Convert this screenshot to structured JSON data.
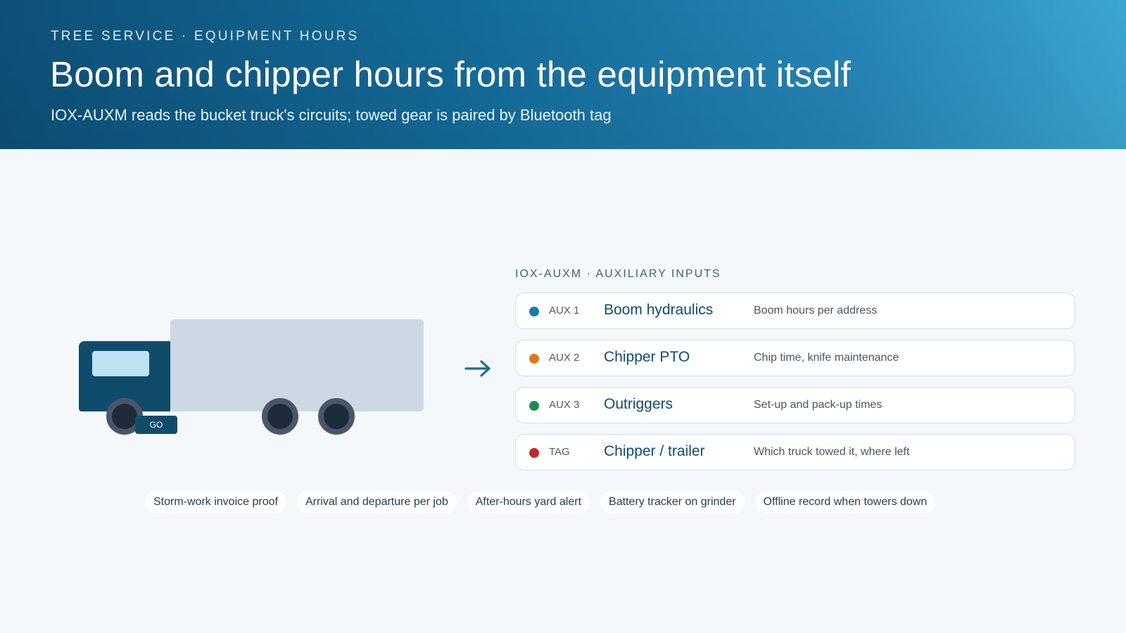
{
  "header": {
    "eyebrow": "TREE SERVICE · EQUIPMENT HOURS",
    "title": "Boom and chipper hours from the equipment itself",
    "subtitle": "IOX-AUXM reads the bucket truck's circuits; towed gear is paired by Bluetooth tag"
  },
  "truck": {
    "badge": "GO"
  },
  "aux": {
    "heading": "IOX-AUXM · AUXILIARY INPUTS",
    "rows": [
      {
        "code": "AUX 1",
        "name": "Boom hydraulics",
        "desc": "Boom hours per address",
        "color": "#1b7aa8"
      },
      {
        "code": "AUX 2",
        "name": "Chipper PTO",
        "desc": "Chip time, knife maintenance",
        "color": "#dd7a1c"
      },
      {
        "code": "AUX 3",
        "name": "Outriggers",
        "desc": "Set-up and pack-up times",
        "color": "#1f8a4c"
      },
      {
        "code": "TAG",
        "name": "Chipper / trailer",
        "desc": "Which truck towed it, where left",
        "color": "#c0282d"
      }
    ]
  },
  "chips": [
    "Storm-work invoice proof",
    "Arrival and departure per job",
    "After-hours yard alert",
    "Battery tracker on grinder",
    "Offline record when towers down"
  ],
  "icons": {
    "arrow": "arrow-right-icon",
    "truck": "bucket-truck-illustration"
  }
}
